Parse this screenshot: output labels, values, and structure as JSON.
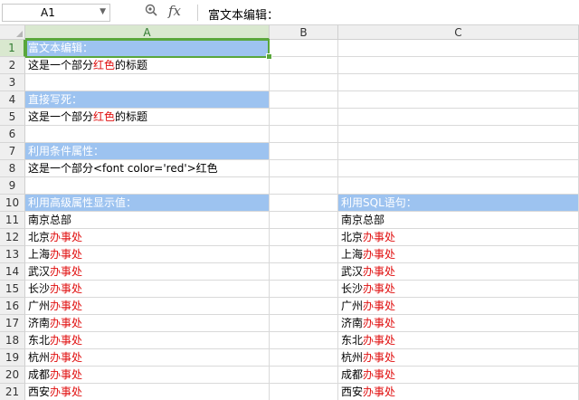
{
  "formula_bar": {
    "cell_ref": "A1",
    "content": "富文本编辑："
  },
  "columns": [
    "A",
    "B",
    "C"
  ],
  "rows": [
    {
      "num": "1",
      "a": [
        {
          "t": "富文本编辑：",
          "red": false
        }
      ],
      "c": [],
      "highlight": "a"
    },
    {
      "num": "2",
      "a": [
        {
          "t": "这是一个部分",
          "red": false
        },
        {
          "t": "红色",
          "red": true
        },
        {
          "t": "的标题",
          "red": false
        }
      ],
      "c": [],
      "highlight": ""
    },
    {
      "num": "3",
      "a": [],
      "c": [],
      "highlight": ""
    },
    {
      "num": "4",
      "a": [
        {
          "t": "直接写死：",
          "red": false
        }
      ],
      "c": [],
      "highlight": "a"
    },
    {
      "num": "5",
      "a": [
        {
          "t": "这是一个部分",
          "red": false
        },
        {
          "t": "红色",
          "red": true
        },
        {
          "t": "的标题",
          "red": false
        }
      ],
      "c": [],
      "highlight": ""
    },
    {
      "num": "6",
      "a": [],
      "c": [],
      "highlight": ""
    },
    {
      "num": "7",
      "a": [
        {
          "t": "利用条件属性：",
          "red": false
        }
      ],
      "c": [],
      "highlight": "a"
    },
    {
      "num": "8",
      "a": [
        {
          "t": "这是一个部分<font color='red'>红色",
          "red": false
        }
      ],
      "c": [],
      "highlight": ""
    },
    {
      "num": "9",
      "a": [],
      "c": [],
      "highlight": ""
    },
    {
      "num": "10",
      "a": [
        {
          "t": "利用高级属性显示值：",
          "red": false
        }
      ],
      "c": [
        {
          "t": "利用SQL语句：",
          "red": false
        }
      ],
      "highlight": "ac"
    },
    {
      "num": "11",
      "a": [
        {
          "t": "南京总部",
          "red": false
        }
      ],
      "c": [
        {
          "t": "南京总部",
          "red": false
        }
      ],
      "highlight": ""
    },
    {
      "num": "12",
      "a": [
        {
          "t": "北京",
          "red": false
        },
        {
          "t": "办事处",
          "red": true
        }
      ],
      "c": [
        {
          "t": "北京",
          "red": false
        },
        {
          "t": "办事处",
          "red": true
        }
      ],
      "highlight": ""
    },
    {
      "num": "13",
      "a": [
        {
          "t": "上海",
          "red": false
        },
        {
          "t": "办事处",
          "red": true
        }
      ],
      "c": [
        {
          "t": "上海",
          "red": false
        },
        {
          "t": "办事处",
          "red": true
        }
      ],
      "highlight": ""
    },
    {
      "num": "14",
      "a": [
        {
          "t": "武汉",
          "red": false
        },
        {
          "t": "办事处",
          "red": true
        }
      ],
      "c": [
        {
          "t": "武汉",
          "red": false
        },
        {
          "t": "办事处",
          "red": true
        }
      ],
      "highlight": ""
    },
    {
      "num": "15",
      "a": [
        {
          "t": "长沙",
          "red": false
        },
        {
          "t": "办事处",
          "red": true
        }
      ],
      "c": [
        {
          "t": "长沙",
          "red": false
        },
        {
          "t": "办事处",
          "red": true
        }
      ],
      "highlight": ""
    },
    {
      "num": "16",
      "a": [
        {
          "t": "广州",
          "red": false
        },
        {
          "t": "办事处",
          "red": true
        }
      ],
      "c": [
        {
          "t": "广州",
          "red": false
        },
        {
          "t": "办事处",
          "red": true
        }
      ],
      "highlight": ""
    },
    {
      "num": "17",
      "a": [
        {
          "t": "济南",
          "red": false
        },
        {
          "t": "办事处",
          "red": true
        }
      ],
      "c": [
        {
          "t": "济南",
          "red": false
        },
        {
          "t": "办事处",
          "red": true
        }
      ],
      "highlight": ""
    },
    {
      "num": "18",
      "a": [
        {
          "t": "东北",
          "red": false
        },
        {
          "t": "办事处",
          "red": true
        }
      ],
      "c": [
        {
          "t": "东北",
          "red": false
        },
        {
          "t": "办事处",
          "red": true
        }
      ],
      "highlight": ""
    },
    {
      "num": "19",
      "a": [
        {
          "t": "杭州",
          "red": false
        },
        {
          "t": "办事处",
          "red": true
        }
      ],
      "c": [
        {
          "t": "杭州",
          "red": false
        },
        {
          "t": "办事处",
          "red": true
        }
      ],
      "highlight": ""
    },
    {
      "num": "20",
      "a": [
        {
          "t": "成都",
          "red": false
        },
        {
          "t": "办事处",
          "red": true
        }
      ],
      "c": [
        {
          "t": "成都",
          "red": false
        },
        {
          "t": "办事处",
          "red": true
        }
      ],
      "highlight": ""
    },
    {
      "num": "21",
      "a": [
        {
          "t": "西安",
          "red": false
        },
        {
          "t": "办事处",
          "red": true
        }
      ],
      "c": [
        {
          "t": "西安",
          "red": false
        },
        {
          "t": "办事处",
          "red": true
        }
      ],
      "highlight": ""
    }
  ],
  "colors": {
    "header_fill": "#9dc3f0",
    "accent_red": "#e01010",
    "selection_green": "#5aa73c"
  },
  "icons": {
    "zoom": "magnifier-icon",
    "function": "fx-icon"
  }
}
